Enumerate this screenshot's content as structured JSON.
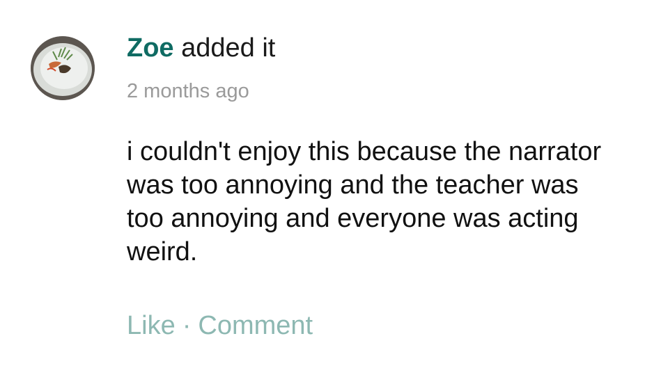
{
  "comment": {
    "author": "Zoe",
    "action_text": " added it",
    "timestamp": "2 months ago",
    "body": "i couldn't enjoy this because the narrator was too annoying and the teacher was too annoying and everyone was acting weird.",
    "like_label": "Like",
    "separator": "·",
    "comment_label": "Comment"
  },
  "colors": {
    "author": "#0f6b63",
    "timestamp": "#9a9a9a",
    "actions": "#8db8b2",
    "body": "#111111"
  },
  "icons": {
    "avatar": "user-avatar-photo"
  }
}
